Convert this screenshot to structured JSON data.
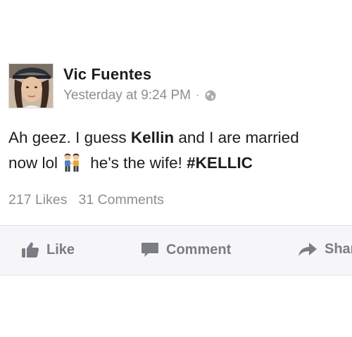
{
  "post": {
    "author": "Vic Fuentes",
    "timestamp": "Yesterday at 9:24 PM",
    "separator": "·",
    "privacy_icon": "globe-icon",
    "text": {
      "part1": "Ah geez. I guess ",
      "mention": "Kellin",
      "part2": " and I are married",
      "line2_start": "now lol",
      "emoji": "two-men-holding-hands-emoji",
      "line2_end": " he's the wife! ",
      "hashtag": "#KELLIC"
    },
    "likes": "217 Likes",
    "comments": "31 Comments"
  },
  "actions": {
    "like_label": "Like",
    "like_icon": "thumbs-up-icon",
    "comment_label": "Comment",
    "comment_icon": "speech-bubble-icon",
    "share_label": "Share",
    "share_icon": "share-arrow-icon"
  },
  "colors": {
    "text": "#1d1d1f",
    "secondary_text": "#8e8e8e",
    "action_text": "#7a7d84",
    "action_bar_bg": "#f6f6f8"
  }
}
